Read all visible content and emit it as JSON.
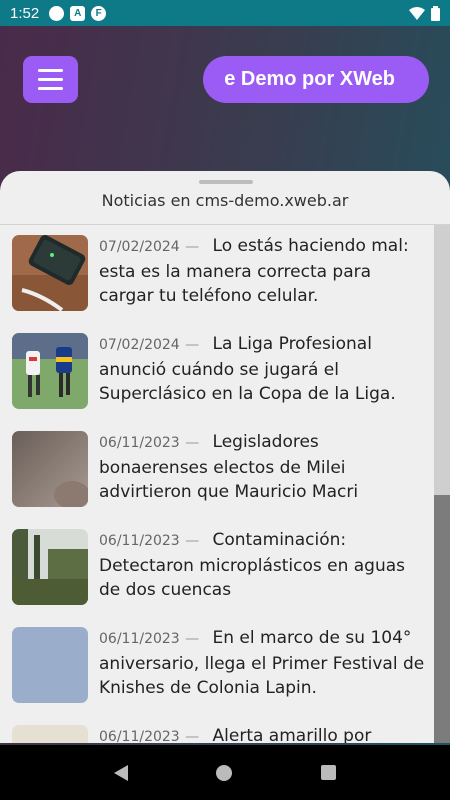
{
  "status_bar": {
    "time": "1:52",
    "icons": [
      "circle-notification-icon",
      "a-notification-icon",
      "f-notification-icon",
      "wifi-icon",
      "battery-icon"
    ]
  },
  "header": {
    "menu_icon": "hamburger-menu-icon",
    "title": "e Demo por XWeb",
    "accent_color": "#9b5cf6"
  },
  "sheet": {
    "title": "Noticias en cms-demo.xweb.ar"
  },
  "news": [
    {
      "date": "07/02/2024",
      "dash": "—",
      "headline": "Lo estás haciendo mal: esta es la manera correcta para cargar tu teléfono celular.",
      "thumb": "phone-charging-photo"
    },
    {
      "date": "07/02/2024",
      "dash": "—",
      "headline": "La Liga Profesional anunció cuándo se jugará el Superclásico en la Copa de la Liga.",
      "thumb": "soccer-players-photo"
    },
    {
      "date": "06/11/2023",
      "dash": "—",
      "headline": "Legisladores bonaerenses electos de Milei advirtieron que Mauricio Macri",
      "thumb": "person-blurred-photo"
    },
    {
      "date": "06/11/2023",
      "dash": "—",
      "headline": "Contaminación: Detectaron microplásticos en aguas de dos cuencas",
      "thumb": "river-trees-photo"
    },
    {
      "date": "06/11/2023",
      "dash": "—",
      "headline": "En el marco de su 104° aniversario, llega el Primer Festival de Knishes de Colonia Lapin.",
      "thumb": "placeholder-blue-photo"
    },
    {
      "date": "06/11/2023",
      "dash": "—",
      "headline": "Alerta amarillo por",
      "thumb": "placeholder-beige-photo"
    }
  ],
  "nav": {
    "back": "back-icon",
    "home": "home-icon",
    "recent": "recent-apps-icon"
  }
}
